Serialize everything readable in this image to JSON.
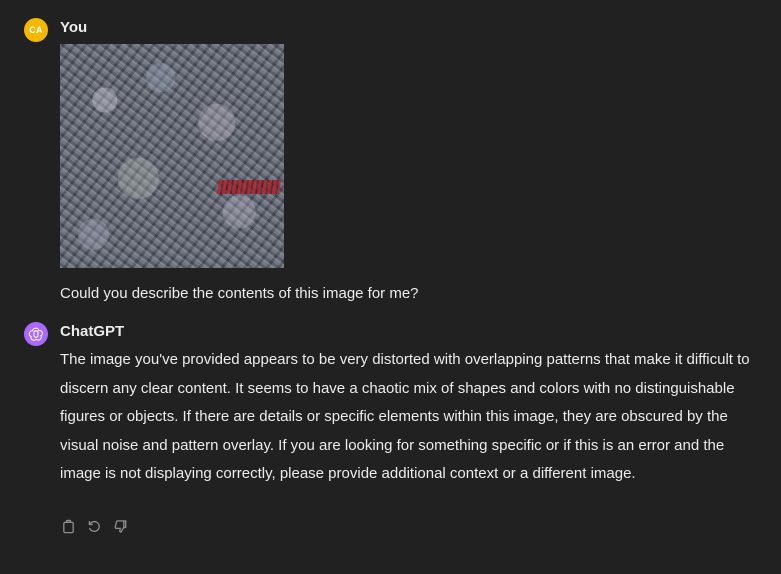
{
  "user": {
    "avatar_initials": "CA",
    "avatar_color": "#f5b800",
    "name": "You",
    "attached_image": "uploaded-image",
    "message": "Could you describe the contents of this image for me?"
  },
  "assistant": {
    "avatar_icon": "openai-logo-icon",
    "avatar_color": "#ab68ff",
    "name": "ChatGPT",
    "message": "The image you've provided appears to be very distorted with overlapping patterns that make it difficult to discern any clear content. It seems to have a chaotic mix of shapes and colors with no distinguishable figures or objects. If there are details or specific elements within this image, they are obscured by the visual noise and pattern overlay. If you are looking for something specific or if this is an error and the image is not displaying correctly, please provide additional context or a different image.",
    "actions": [
      {
        "icon": "copy-icon"
      },
      {
        "icon": "regenerate-icon"
      },
      {
        "icon": "thumbs-down-icon"
      }
    ]
  },
  "colors": {
    "background": "#212121",
    "text": "#ececec",
    "icon": "#8e8e8e"
  }
}
